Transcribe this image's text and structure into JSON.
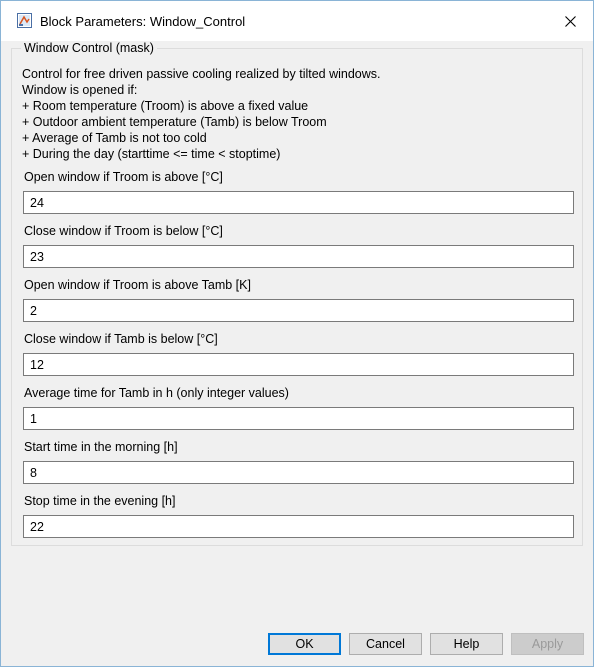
{
  "window": {
    "title": "Block Parameters: Window_Control"
  },
  "group": {
    "label": "Window Control (mask)"
  },
  "description": [
    "Control for free driven passive cooling realized by tilted windows.",
    "Window is opened if:",
    "+ Room temperature (Troom) is above a fixed value",
    "+ Outdoor ambient temperature (Tamb) is below Troom",
    "+ Average of Tamb is not too cold",
    "+ During the day (starttime <= time < stoptime)"
  ],
  "parameters": [
    {
      "label": "Open window if Troom is above [°C]",
      "value": "24"
    },
    {
      "label": "Close window if Troom is below [°C]",
      "value": "23"
    },
    {
      "label": "Open window if Troom is above Tamb [K]",
      "value": "2"
    },
    {
      "label": "Close window if Tamb is below [°C]",
      "value": "12"
    },
    {
      "label": "Average time for Tamb in h (only integer values)",
      "value": "1"
    },
    {
      "label": "Start time in the morning [h]",
      "value": "8"
    },
    {
      "label": "Stop time in the evening [h]",
      "value": "22"
    }
  ],
  "buttons": {
    "ok": "OK",
    "cancel": "Cancel",
    "help": "Help",
    "apply": "Apply"
  },
  "icons": {
    "app": "simulink-block-icon",
    "close": "close-icon"
  },
  "colors": {
    "accent": "#0078d7",
    "dialog_bg": "#f0f0f0",
    "window_border": "#8ab4d6"
  }
}
